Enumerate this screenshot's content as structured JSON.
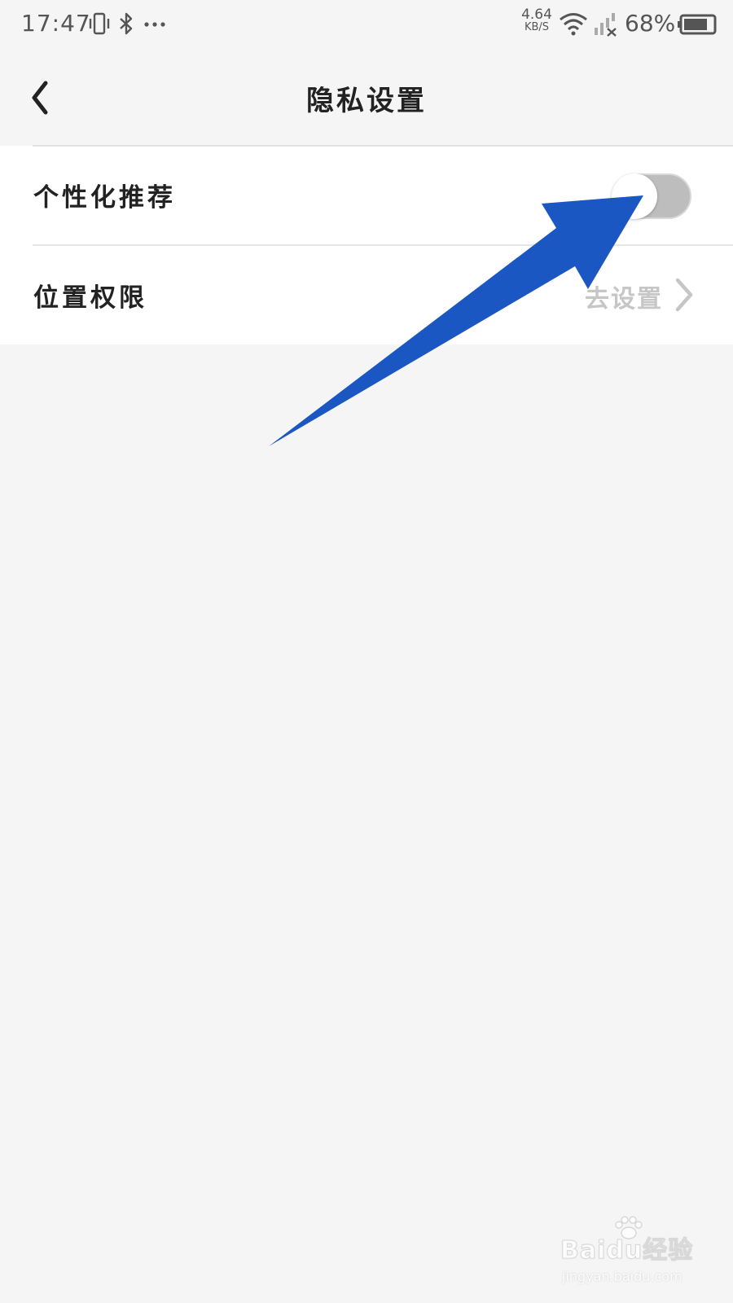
{
  "status_bar": {
    "time": "17:47",
    "net_speed_value": "4.64",
    "net_speed_unit": "KB/S",
    "battery_percent": "68%",
    "icons": [
      "vibrate-icon",
      "bluetooth-icon",
      "more-dots-icon",
      "wifi-icon",
      "signal-icon",
      "battery-icon"
    ]
  },
  "header": {
    "title": "隐私设置",
    "back_icon": "chevron-left-icon"
  },
  "settings": {
    "rows": [
      {
        "label": "个性化推荐",
        "control": "toggle",
        "toggle_on": false
      },
      {
        "label": "位置权限",
        "value": "去设置",
        "control": "link"
      }
    ]
  },
  "watermark": {
    "brand": "Baidu经验",
    "url": "jingyan.baidu.com"
  },
  "colors": {
    "background": "#f5f5f5",
    "card": "#ffffff",
    "text_primary": "#222222",
    "text_secondary": "#c6c6c6",
    "toggle_off": "#bdbdbd",
    "annotation_arrow": "#1a57c2"
  }
}
